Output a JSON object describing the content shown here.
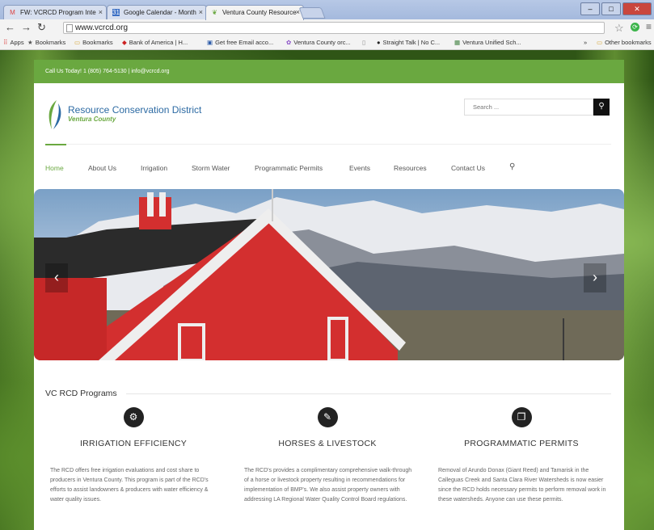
{
  "browser": {
    "tabs": [
      {
        "label": "FW: VCRCD Program Inte",
        "icon": "gmail-icon"
      },
      {
        "label": "Google Calendar - Month",
        "icon": "calendar-icon"
      },
      {
        "label": "Ventura County Resource",
        "icon": "leaf-icon"
      }
    ],
    "url": "www.vcrcd.org",
    "bookmarks": [
      "Apps",
      "Bookmarks",
      "Bookmarks",
      "Bank of America | H...",
      "Get free Email acco...",
      "Ventura County orc...",
      "Straight Talk | No C...",
      "Ventura Unified Sch..."
    ],
    "other_bookmarks": "Other bookmarks"
  },
  "site": {
    "topbar": "Call Us Today! 1 (805) 764-5130  |  info@vcrcd.org",
    "logo_title": "Resource Conservation District",
    "logo_subtitle": "Ventura County",
    "search_placeholder": "Search ...",
    "nav": [
      "Home",
      "About Us",
      "Irrigation",
      "Storm Water",
      "Programmatic Permits",
      "Events",
      "Resources",
      "Contact Us"
    ],
    "section_title": "VC RCD Programs",
    "programs": [
      {
        "title": "IRRIGATION EFFICIENCY",
        "text": "The RCD offers free irrigation evaluations and cost share to producers in Ventura County. This program is part of the RCD's efforts to assist landowners & producers with water efficiency & water quality issues."
      },
      {
        "title": "HORSES & LIVESTOCK",
        "text": "The RCD's provides a complimentary comprehensive walk-through of a horse or livestock property resulting in recommendations for implementation of BMP's. We also assist property owners with addressing LA Regional Water Quality Control Board regulations."
      },
      {
        "title": "PROGRAMMATIC PERMITS",
        "text": "Removal of Arundo Donax (Giant Reed) and Tamarisk in the Calleguas Creek and Santa Clara River Watersheds is now easier since the RCD holds necessary permits to perform removal work in these watersheds. Anyone can use these permits."
      }
    ]
  },
  "colors": {
    "brand_green": "#6aa840",
    "brand_blue": "#2c6aa3"
  }
}
